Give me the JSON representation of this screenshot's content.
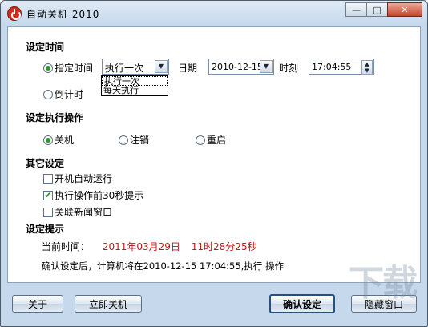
{
  "window": {
    "title": "自动关机 2010",
    "minimize_glyph": "—",
    "maximize_glyph": "□",
    "close_glyph": "✕"
  },
  "set_time": {
    "heading": "设定时间",
    "specify_label": "指定时间",
    "mode_value": "执行一次",
    "mode_options": [
      "执行一次",
      "每天执行"
    ],
    "date_label": "日期",
    "date_value": "2010-12-15",
    "time_label": "时刻",
    "time_value": "17:04:55",
    "countdown_label": "倒计时"
  },
  "operation": {
    "heading": "设定执行操作",
    "options": [
      "关机",
      "注销",
      "重启"
    ]
  },
  "other": {
    "heading": "其它设定",
    "autostart_label": "开机自动运行",
    "remind_label": "执行操作前30秒提示",
    "news_label": "关联新闻窗口"
  },
  "tips": {
    "heading": "设定提示",
    "current_time_label": "当前时间：",
    "current_date": "2011年03月29日",
    "current_time": "11时28分25秒",
    "confirm_text": "确认设定后，计算机将在2010-12-15 17:04:55,执行  操作"
  },
  "buttons": {
    "about": "关于",
    "shutdown_now": "立即关机",
    "confirm": "确认设定",
    "hide": "隐藏窗口"
  },
  "icons": {
    "app": "power-icon",
    "combo_arrow": "▼",
    "spin_up": "▲",
    "spin_down": "▼",
    "check_mark": "✔"
  },
  "watermark": "下载"
}
